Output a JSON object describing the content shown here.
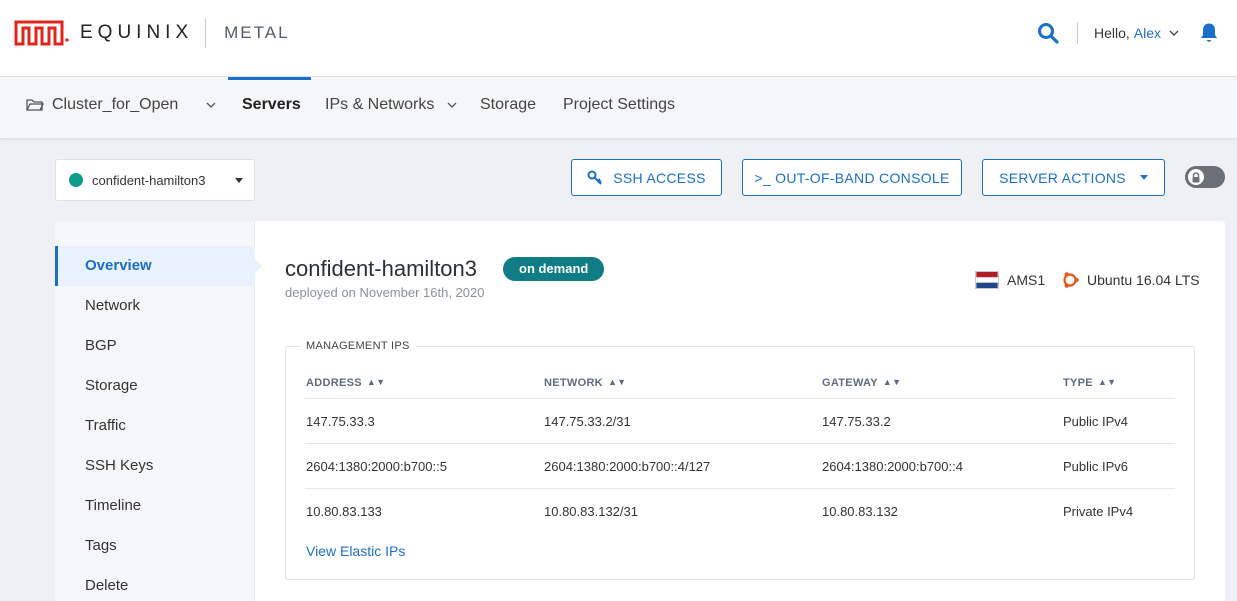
{
  "header": {
    "brand": "EQUINIX",
    "product": "METAL",
    "greeting": "Hello,",
    "user": "Alex"
  },
  "subnav": {
    "project": "Cluster_for_Open",
    "tabs": [
      "Servers",
      "IPs & Networks",
      "Storage",
      "Project Settings"
    ]
  },
  "toolbar": {
    "server_name": "confident-hamilton3",
    "ssh_label": "SSH ACCESS",
    "console_label": ">_ OUT-OF-BAND CONSOLE",
    "actions_label": "SERVER ACTIONS"
  },
  "sidebar": {
    "items": [
      "Overview",
      "Network",
      "BGP",
      "Storage",
      "Traffic",
      "SSH Keys",
      "Timeline",
      "Tags",
      "Delete"
    ]
  },
  "server": {
    "title": "confident-hamilton3",
    "badge": "on demand",
    "deployed": "deployed on November 16th, 2020",
    "location": "AMS1",
    "os": "Ubuntu 16.04 LTS"
  },
  "management": {
    "legend": "MANAGEMENT IPS",
    "columns": [
      "ADDRESS",
      "NETWORK",
      "GATEWAY",
      "TYPE"
    ],
    "rows": [
      [
        "147.75.33.3",
        "147.75.33.2/31",
        "147.75.33.2",
        "Public IPv4"
      ],
      [
        "2604:1380:2000:b700::5",
        "2604:1380:2000:b700::4/127",
        "2604:1380:2000:b700::4",
        "Public IPv6"
      ],
      [
        "10.80.83.133",
        "10.80.83.132/31",
        "10.80.83.132",
        "Private IPv4"
      ]
    ],
    "link": "View Elastic IPs"
  },
  "colors": {
    "accent": "#1a6fc9",
    "badge": "#0f7c86",
    "status_dot": "#119b8c",
    "logo_red": "#e1251b"
  }
}
